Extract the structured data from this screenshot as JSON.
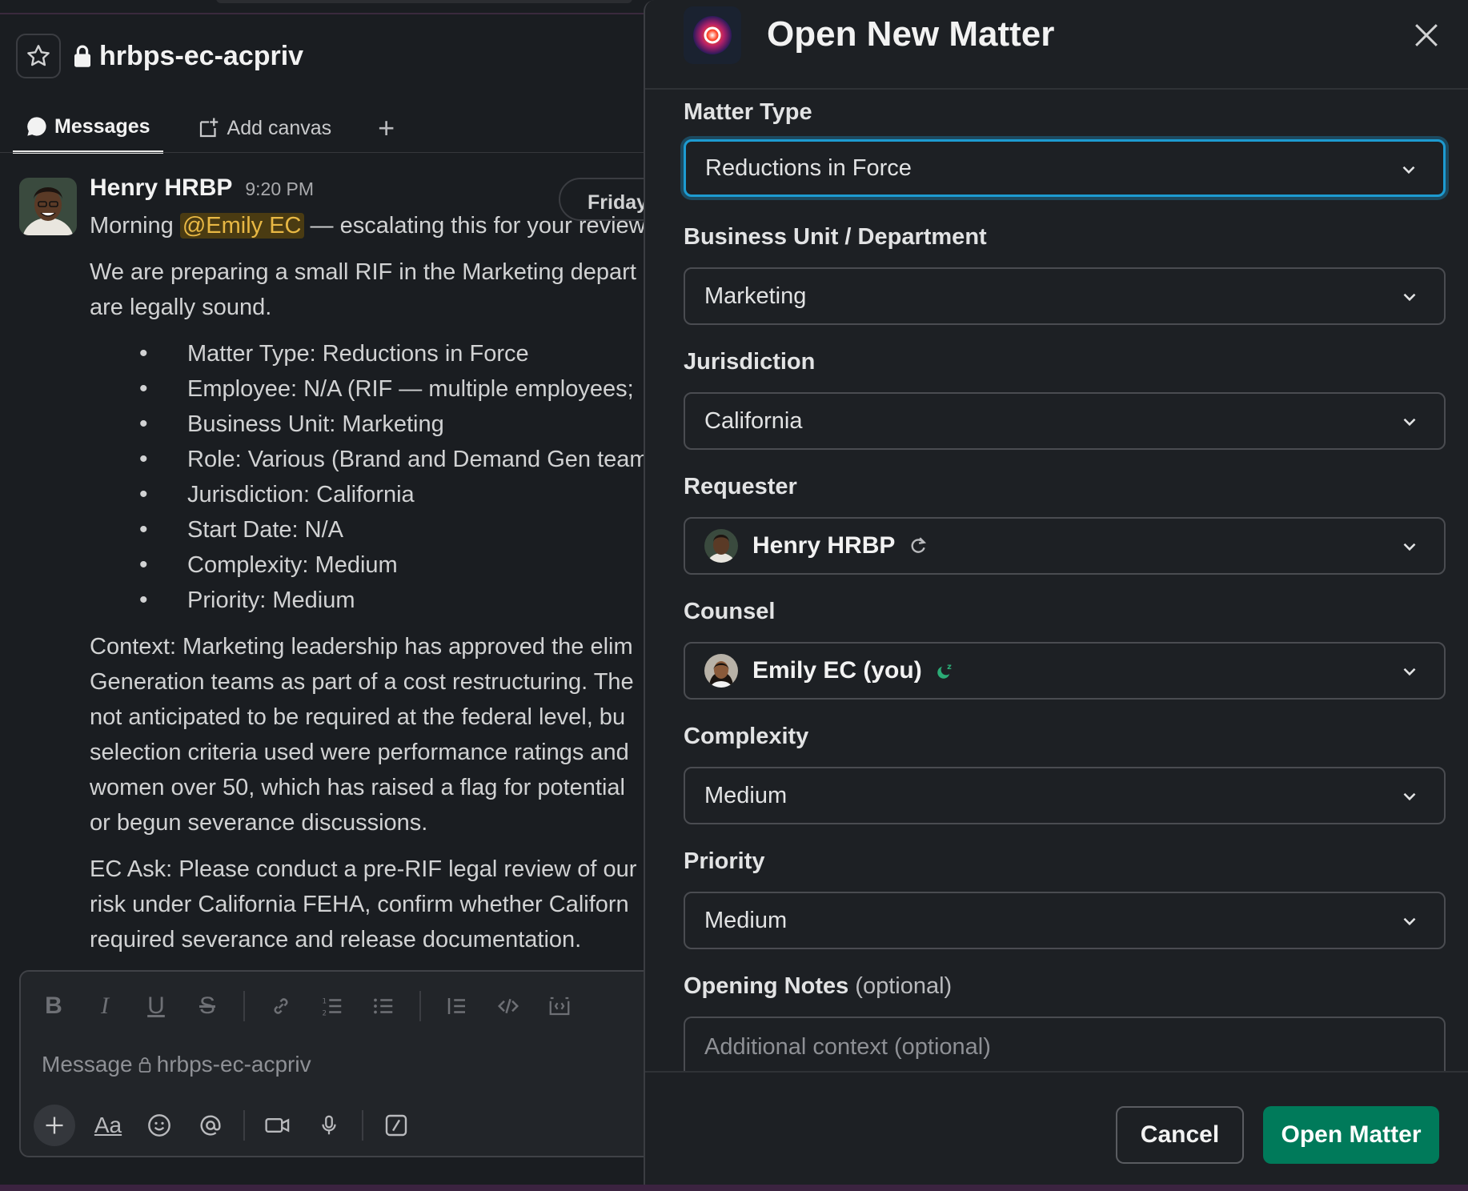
{
  "channel": {
    "name": "hrbps-ec-acpriv",
    "tabs": [
      {
        "label": "Messages"
      },
      {
        "label": "Add canvas"
      }
    ]
  },
  "message": {
    "author": "Henry HRBP",
    "time": "9:20 PM",
    "date_divider": "Friday",
    "intro_before": "Morning ",
    "mention": "@Emily EC",
    "intro_after": " — escalating this for your review",
    "para1_line1": "We are preparing a small RIF in the Marketing depart",
    "para1_line2": "are legally sound.",
    "bullets": [
      "Matter Type: Reductions in Force",
      "Employee: N/A (RIF — multiple employees;",
      "Business Unit: Marketing",
      "Role: Various (Brand and Demand Gen team",
      "Jurisdiction: California",
      "Start Date: N/A",
      "Complexity: Medium",
      "Priority: Medium"
    ],
    "context_lines": [
      "Context: Marketing leadership has approved the elim",
      "Generation teams as part of a cost restructuring. The",
      "not anticipated to be required at the federal level, bu",
      "selection criteria used were performance ratings and",
      "women over 50, which has raised a flag for potential",
      "or begun severance discussions."
    ],
    "ask_lines": [
      "EC Ask: Please conduct a pre-RIF legal review of our",
      "risk under California FEHA, confirm whether Californ",
      "required severance and release documentation."
    ]
  },
  "composer": {
    "placeholder_prefix": "Message",
    "placeholder_channel": "hrbps-ec-acpriv",
    "format_label": "Aa"
  },
  "modal": {
    "title": "Open New Matter",
    "fields": {
      "matter_type": {
        "label": "Matter Type",
        "value": "Reductions in Force"
      },
      "business_unit": {
        "label": "Business Unit / Department",
        "value": "Marketing"
      },
      "jurisdiction": {
        "label": "Jurisdiction",
        "value": "California"
      },
      "requester": {
        "label": "Requester",
        "value": "Henry HRBP"
      },
      "counsel": {
        "label": "Counsel",
        "value": "Emily EC (you)"
      },
      "complexity": {
        "label": "Complexity",
        "value": "Medium"
      },
      "priority": {
        "label": "Priority",
        "value": "Medium"
      },
      "opening_notes": {
        "label": "Opening Notes",
        "optional": "(optional)",
        "placeholder": "Additional context (optional)"
      }
    },
    "cancel_label": "Cancel",
    "submit_label": "Open Matter"
  },
  "colors": {
    "primary_button": "#007a5a",
    "focus_ring": "#1d9bd1",
    "mention_text": "#e8b844"
  }
}
